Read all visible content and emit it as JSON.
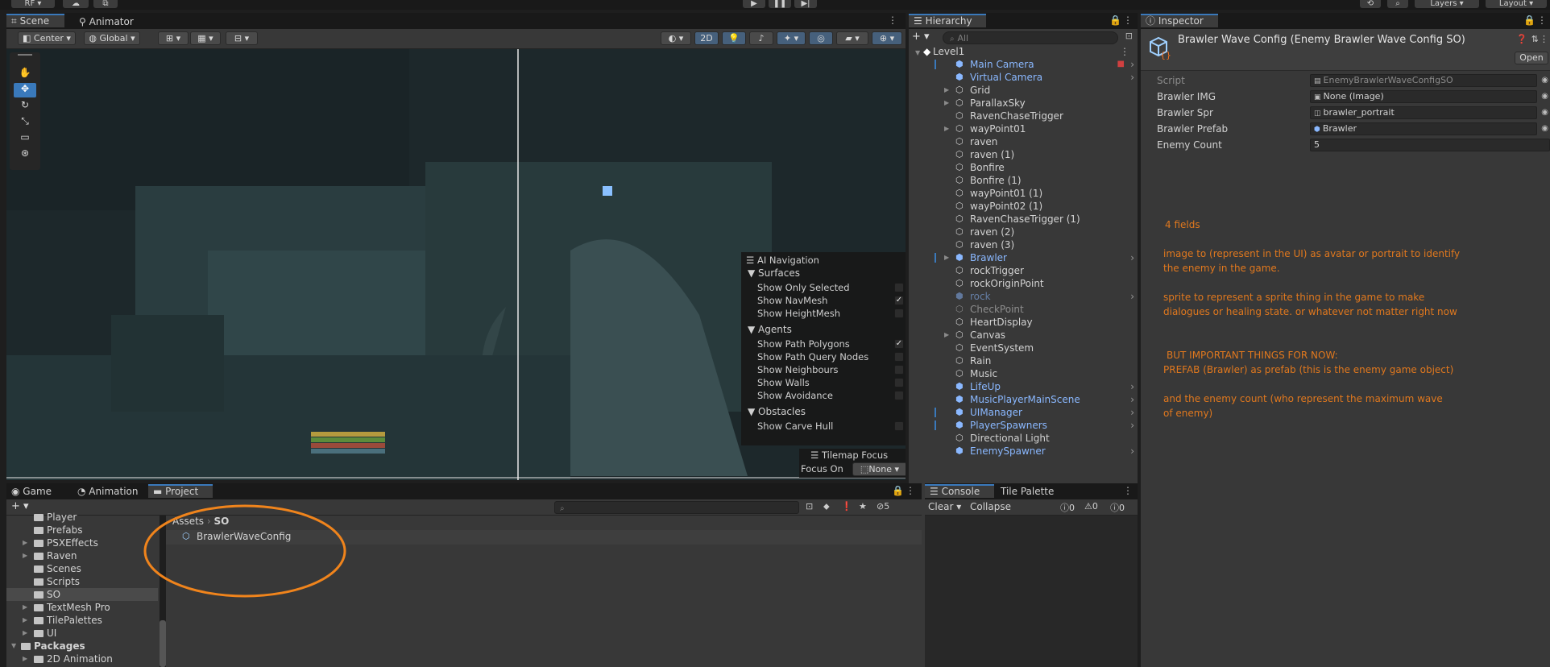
{
  "topbar": {
    "account": "RF",
    "layers": "Layers",
    "layout": "Layout"
  },
  "scene_tabs": [
    "Scene",
    "Animator"
  ],
  "scene_toolbar": {
    "pivot": "Center",
    "space": "Global",
    "mode_2d": "2D"
  },
  "ai_navigation": {
    "title": "AI Navigation",
    "surfaces_header": "Surfaces",
    "surfaces": [
      {
        "label": "Show Only Selected",
        "checked": false
      },
      {
        "label": "Show NavMesh",
        "checked": true
      },
      {
        "label": "Show HeightMesh",
        "checked": false
      }
    ],
    "agents_header": "Agents",
    "agents": [
      {
        "label": "Show Path Polygons",
        "checked": true
      },
      {
        "label": "Show Path Query Nodes",
        "checked": false
      },
      {
        "label": "Show Neighbours",
        "checked": false
      },
      {
        "label": "Show Walls",
        "checked": false
      },
      {
        "label": "Show Avoidance",
        "checked": false
      }
    ],
    "obstacles_header": "Obstacles",
    "obstacles": [
      {
        "label": "Show Carve Hull",
        "checked": false
      }
    ]
  },
  "tilemap_focus": {
    "title": "Tilemap Focus",
    "label": "Focus On",
    "value": "None"
  },
  "hierarchy": {
    "tab": "Hierarchy",
    "search_placeholder": "All",
    "scene": "Level1",
    "items": [
      {
        "name": "Main Camera",
        "blue": true
      },
      {
        "name": "Virtual Camera",
        "blue": true
      },
      {
        "name": "Grid",
        "blue": false
      },
      {
        "name": "ParallaxSky",
        "blue": false
      },
      {
        "name": "RavenChaseTrigger",
        "blue": false
      },
      {
        "name": "wayPoint01",
        "blue": false
      },
      {
        "name": "raven",
        "blue": false
      },
      {
        "name": "raven (1)",
        "blue": false
      },
      {
        "name": "Bonfire",
        "blue": false
      },
      {
        "name": "Bonfire (1)",
        "blue": false
      },
      {
        "name": "wayPoint01 (1)",
        "blue": false
      },
      {
        "name": "wayPoint02 (1)",
        "blue": false
      },
      {
        "name": "RavenChaseTrigger (1)",
        "blue": false
      },
      {
        "name": "raven (2)",
        "blue": false
      },
      {
        "name": "raven (3)",
        "blue": false
      },
      {
        "name": "Brawler",
        "blue": true
      },
      {
        "name": "rockTrigger",
        "blue": false
      },
      {
        "name": "rockOriginPoint",
        "blue": false
      },
      {
        "name": "rock",
        "blue": true,
        "dim": true
      },
      {
        "name": "CheckPoint",
        "blue": false,
        "dim": true
      },
      {
        "name": "HeartDisplay",
        "blue": false
      },
      {
        "name": "Canvas",
        "blue": false
      },
      {
        "name": "EventSystem",
        "blue": false
      },
      {
        "name": "Rain",
        "blue": false
      },
      {
        "name": "Music",
        "blue": false
      },
      {
        "name": "LifeUp",
        "blue": true
      },
      {
        "name": "MusicPlayerMainScene",
        "blue": true
      },
      {
        "name": "UIManager",
        "blue": true
      },
      {
        "name": "PlayerSpawners",
        "blue": true
      },
      {
        "name": "Directional Light",
        "blue": false
      },
      {
        "name": "EnemySpawner",
        "blue": true
      }
    ]
  },
  "inspector": {
    "tab": "Inspector",
    "title": "Brawler Wave Config (Enemy Brawler Wave Config SO)",
    "open_button": "Open",
    "fields": [
      {
        "label": "Script",
        "value": "EnemyBrawlerWaveConfigSO"
      },
      {
        "label": "Brawler IMG",
        "value": "None (Image)"
      },
      {
        "label": "Brawler Spr",
        "value": "brawler_portrait"
      },
      {
        "label": "Brawler Prefab",
        "value": "Brawler"
      },
      {
        "label": "Enemy Count",
        "value": "5"
      }
    ]
  },
  "notes": [
    "4 fields",
    "image to (represent in the UI) as avatar or portrait to identify",
    "the enemy in the game.",
    "sprite to represent a sprite thing in the game to make",
    "dialogues or healing state. or whatever not matter right now",
    "BUT IMPORTANT THINGS FOR NOW:",
    "PREFAB (Brawler) as prefab (this is the enemy game object)",
    "and the enemy count (who represent the maximum wave",
    "of enemy)"
  ],
  "bottom_tabs": [
    "Game",
    "Animation",
    "Project"
  ],
  "project": {
    "folders": [
      "Player",
      "Prefabs",
      "PSXEffects",
      "Raven",
      "Scenes",
      "Scripts",
      "SO",
      "TextMesh Pro",
      "TilePalettes",
      "UI"
    ],
    "packages": "Packages",
    "package_items": [
      "2D Animation"
    ],
    "breadcrumb_root": "Assets",
    "breadcrumb_current": "SO",
    "asset": "BrawlerWaveConfig",
    "hidden_count": "5"
  },
  "console": {
    "tabs": [
      "Console",
      "Tile Palette"
    ],
    "clear": "Clear",
    "collapse": "Collapse",
    "counts": [
      "0",
      "0",
      "0"
    ]
  },
  "colors": {
    "accent": "#3a79bb",
    "note": "#e0781e",
    "highlight_circle": "#f0841c",
    "prefab_blue": "#8ab8ff"
  }
}
